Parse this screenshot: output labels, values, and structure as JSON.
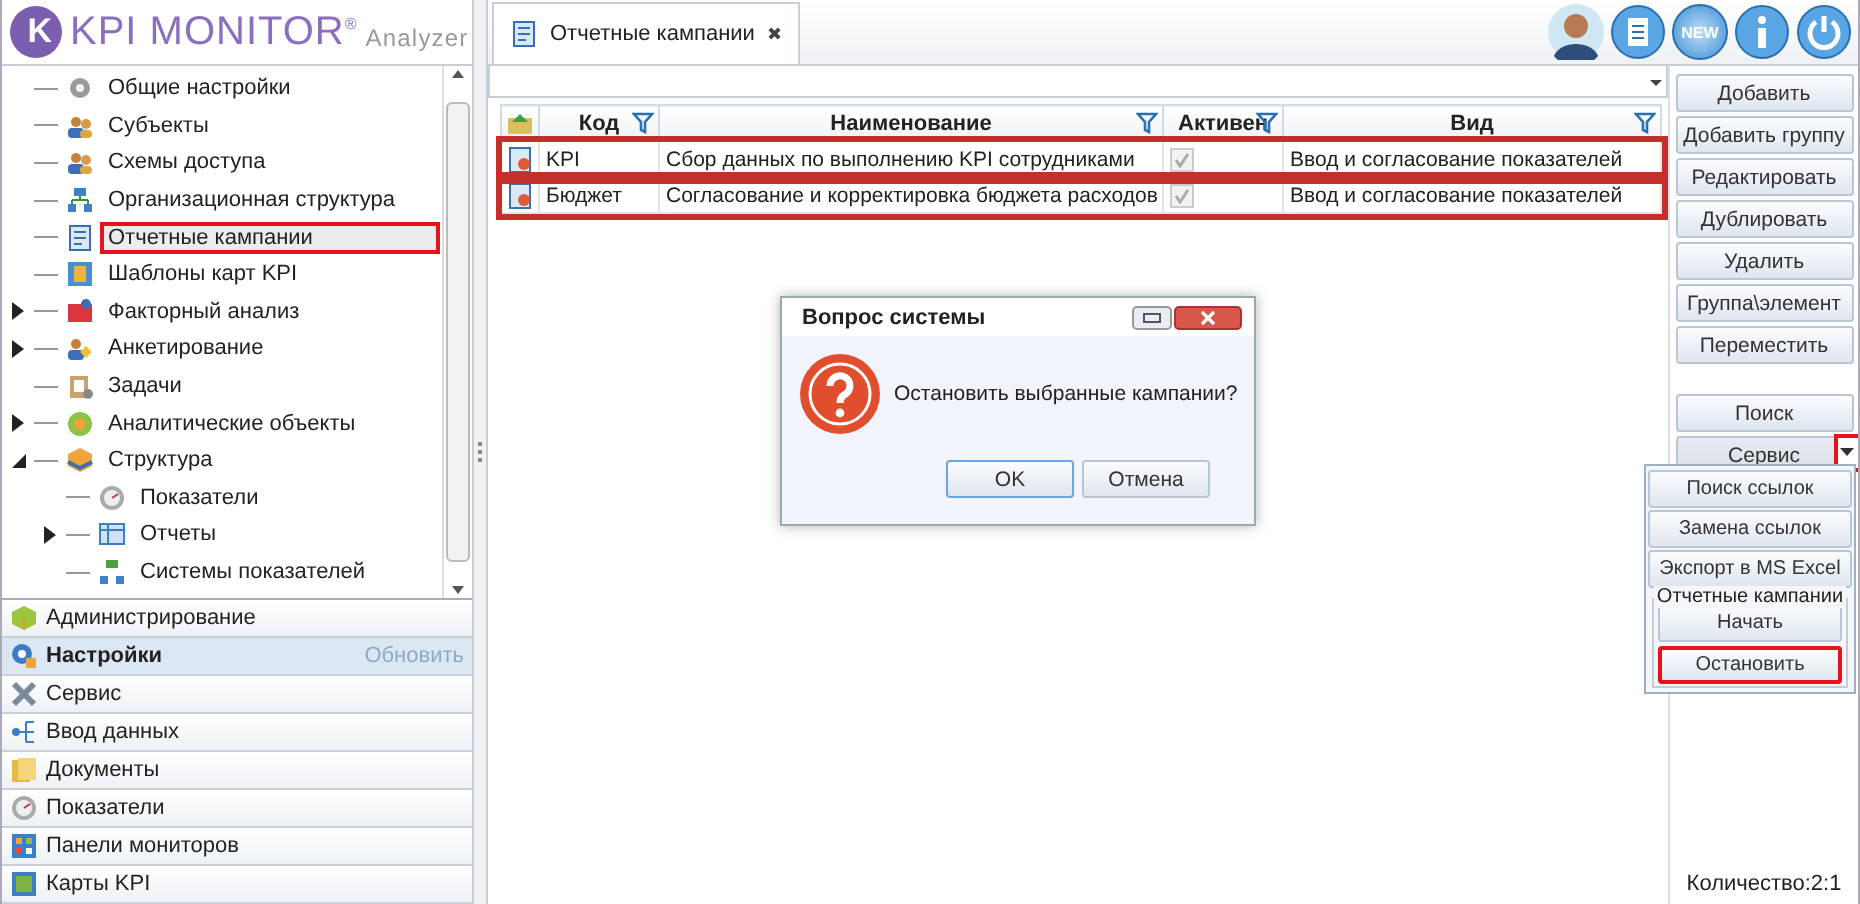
{
  "logo": {
    "mark": "K",
    "name": "KPI MONITOR",
    "reg": "®",
    "sub": "Analyzer"
  },
  "tree": [
    {
      "label": "Общие настройки",
      "expandable": false,
      "expanded": false,
      "selected": false,
      "highlighted": false
    },
    {
      "label": "Субъекты",
      "expandable": false,
      "expanded": false,
      "selected": false,
      "highlighted": false
    },
    {
      "label": "Схемы доступа",
      "expandable": false,
      "expanded": false,
      "selected": false,
      "highlighted": false
    },
    {
      "label": "Организационная структура",
      "expandable": false,
      "expanded": false,
      "selected": false,
      "highlighted": false
    },
    {
      "label": "Отчетные кампании",
      "expandable": false,
      "expanded": false,
      "selected": true,
      "highlighted": true
    },
    {
      "label": "Шаблоны карт KPI",
      "expandable": false,
      "expanded": false,
      "selected": false,
      "highlighted": false
    },
    {
      "label": "Факторный анализ",
      "expandable": true,
      "expanded": false,
      "selected": false,
      "highlighted": false
    },
    {
      "label": "Анкетирование",
      "expandable": true,
      "expanded": false,
      "selected": false,
      "highlighted": false
    },
    {
      "label": "Задачи",
      "expandable": false,
      "expanded": false,
      "selected": false,
      "highlighted": false
    },
    {
      "label": "Аналитические объекты",
      "expandable": true,
      "expanded": false,
      "selected": false,
      "highlighted": false
    },
    {
      "label": "Структура",
      "expandable": true,
      "expanded": true,
      "selected": false,
      "highlighted": false,
      "children": [
        {
          "label": "Показатели",
          "expandable": false,
          "expanded": false,
          "selected": false,
          "highlighted": false
        },
        {
          "label": "Отчеты",
          "expandable": true,
          "expanded": false,
          "selected": false,
          "highlighted": false
        },
        {
          "label": "Системы показателей",
          "expandable": false,
          "expanded": false,
          "selected": false,
          "highlighted": false
        }
      ]
    }
  ],
  "accordion": [
    {
      "label": "Администрирование",
      "selected": false
    },
    {
      "label": "Настройки",
      "selected": true,
      "action": "Обновить"
    },
    {
      "label": "Сервис",
      "selected": false
    },
    {
      "label": "Ввод данных",
      "selected": false
    },
    {
      "label": "Документы",
      "selected": false
    },
    {
      "label": "Показатели",
      "selected": false
    },
    {
      "label": "Панели мониторов",
      "selected": false
    },
    {
      "label": "Карты KPI",
      "selected": false
    }
  ],
  "tabs": [
    {
      "label": "Отчетные кампании",
      "selected": true,
      "close": "✖"
    }
  ],
  "header": {
    "new_label": "NEW"
  },
  "grid": {
    "columns": [
      {
        "label": "Код"
      },
      {
        "label": "Наименование"
      },
      {
        "label": "Активен"
      },
      {
        "label": "Вид"
      }
    ],
    "rows": [
      {
        "code": "KPI",
        "name": "Сбор данных по выполнению KPI сотрудниками",
        "active": true,
        "view": "Ввод и согласование показателей",
        "highlighted": true
      },
      {
        "code": "Бюджет",
        "name": "Согласование и корректировка бюджета расходов",
        "active": true,
        "view": "Ввод и согласование показателей",
        "highlighted": true
      }
    ]
  },
  "actions": [
    {
      "label": "Добавить"
    },
    {
      "label": "Добавить группу"
    },
    {
      "label": "Редактировать"
    },
    {
      "label": "Дублировать"
    },
    {
      "label": "Удалить"
    },
    {
      "label": "Группа\\элемент"
    },
    {
      "label": "Переместить"
    }
  ],
  "tools": [
    {
      "label": "Поиск",
      "dropdown": false,
      "highlighted": false
    },
    {
      "label": "Сервис",
      "dropdown": true,
      "highlighted": true
    }
  ],
  "menu": {
    "items": [
      {
        "label": "Поиск ссылок"
      },
      {
        "label": "Замена ссылок"
      },
      {
        "label": "Экспорт в MS Excel"
      }
    ],
    "group": {
      "title": "Отчетные кампании",
      "items": [
        {
          "label": "Начать",
          "highlighted": false
        },
        {
          "label": "Остановить",
          "highlighted": true
        }
      ]
    }
  },
  "dialog": {
    "title": "Вопрос системы",
    "message": "Остановить выбранные кампании?",
    "buttons": [
      {
        "label": "OK",
        "selected": true
      },
      {
        "label": "Отмена",
        "selected": false
      }
    ]
  },
  "status": "Количество:2:1"
}
